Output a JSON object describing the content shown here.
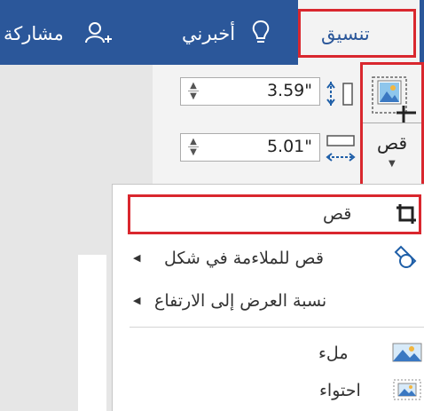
{
  "ribbon": {
    "tabs": [
      {
        "label": "تنسيق"
      },
      {
        "label": "أخبرني"
      },
      {
        "label": "مشاركة"
      }
    ],
    "size": {
      "height_value": "3.59\"",
      "width_value": "5.01\""
    },
    "crop_button_label": "قص"
  },
  "crop_menu": {
    "items": [
      {
        "label": "قص"
      },
      {
        "label": "قص للملاءمة في شكل"
      },
      {
        "label": "نسبة العرض إلى الارتفاع"
      },
      {
        "label": "ملء"
      },
      {
        "label": "احتواء"
      }
    ]
  },
  "colors": {
    "ribbon_blue": "#2b579a",
    "highlight_red": "#d9272e"
  },
  "icons": [
    "share-person-icon",
    "lightbulb-icon",
    "height-icon",
    "width-icon",
    "crop-icon",
    "crop-to-shape-icon",
    "fill-icon",
    "fit-icon"
  ]
}
